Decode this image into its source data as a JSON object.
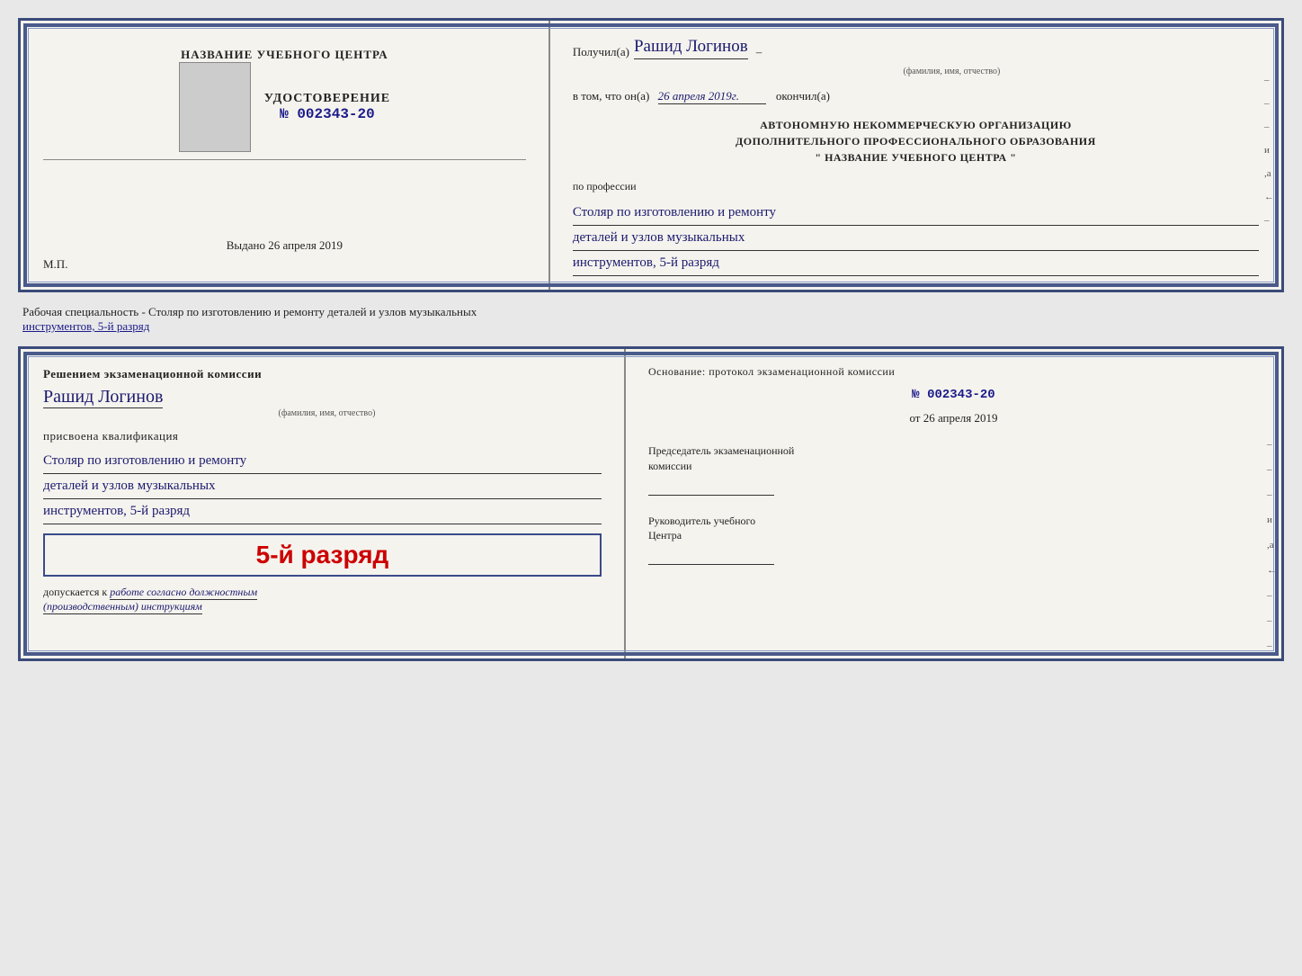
{
  "top_doc": {
    "left": {
      "center_name": "НАЗВАНИЕ УЧЕБНОГО ЦЕНТРА",
      "udostoverenie_label": "УДОСТОВЕРЕНИЕ",
      "number_prefix": "№",
      "number": "002343-20",
      "vydano_label": "Выдано",
      "vydano_date": "26 апреля 2019",
      "mp_label": "М.П."
    },
    "right": {
      "poluchil_label": "Получил(а)",
      "recipient_name": "Рашид Логинов",
      "fio_label": "(фамилия, имя, отчество)",
      "vtom_label": "в том, что он(а)",
      "vtom_date": "26 апреля 2019г.",
      "okonchil_label": "окончил(а)",
      "avt_line1": "АВТОНОМНУЮ НЕКОММЕРЧЕСКУЮ ОРГАНИЗАЦИЮ",
      "avt_line2": "ДОПОЛНИТЕЛЬНОГО ПРОФЕССИОНАЛЬНОГО ОБРАЗОВАНИЯ",
      "avt_line3": "\"    НАЗВАНИЕ УЧЕБНОГО ЦЕНТРА    \"",
      "po_professii_label": "по профессии",
      "profession_line1": "Столяр по изготовлению и ремонту",
      "profession_line2": "деталей и узлов музыкальных",
      "profession_line3": "инструментов, 5-й разряд",
      "dashes": [
        "-",
        "-",
        "-",
        "и",
        ",а",
        "←",
        "-"
      ]
    }
  },
  "specialty_text": {
    "label": "Рабочая специальность - Столяр по изготовлению и ремонту деталей и узлов музыкальных",
    "label2_underline": "инструментов, 5-й разряд"
  },
  "bottom_doc": {
    "left": {
      "resheniem_label": "Решением  экзаменационной  комиссии",
      "name": "Рашид Логинов",
      "fio_label": "(фамилия, имя, отчество)",
      "prisvoena_label": "присвоена квалификация",
      "qual_line1": "Столяр по изготовлению и ремонту",
      "qual_line2": "деталей и узлов музыкальных",
      "qual_line3": "инструментов, 5-й разряд",
      "razryad_big": "5-й разряд",
      "dopuskaetsya_label": "допускается к",
      "dopuskaetsya_text": "работе согласно должностным",
      "dopuskaetsya_text2": "(производственным) инструкциям"
    },
    "right": {
      "osnov_label": "Основание: протокол экзаменационной  комиссии",
      "number_prefix": "№",
      "number": "002343-20",
      "ot_label": "от",
      "ot_date": "26 апреля 2019",
      "pred_label": "Председатель экзаменационной",
      "pred_label2": "комиссии",
      "ruk_label": "Руководитель учебного",
      "ruk_label2": "Центра",
      "dashes": [
        "-",
        "-",
        "-",
        "и",
        ",а",
        "←",
        "-",
        "-",
        "-"
      ]
    }
  }
}
